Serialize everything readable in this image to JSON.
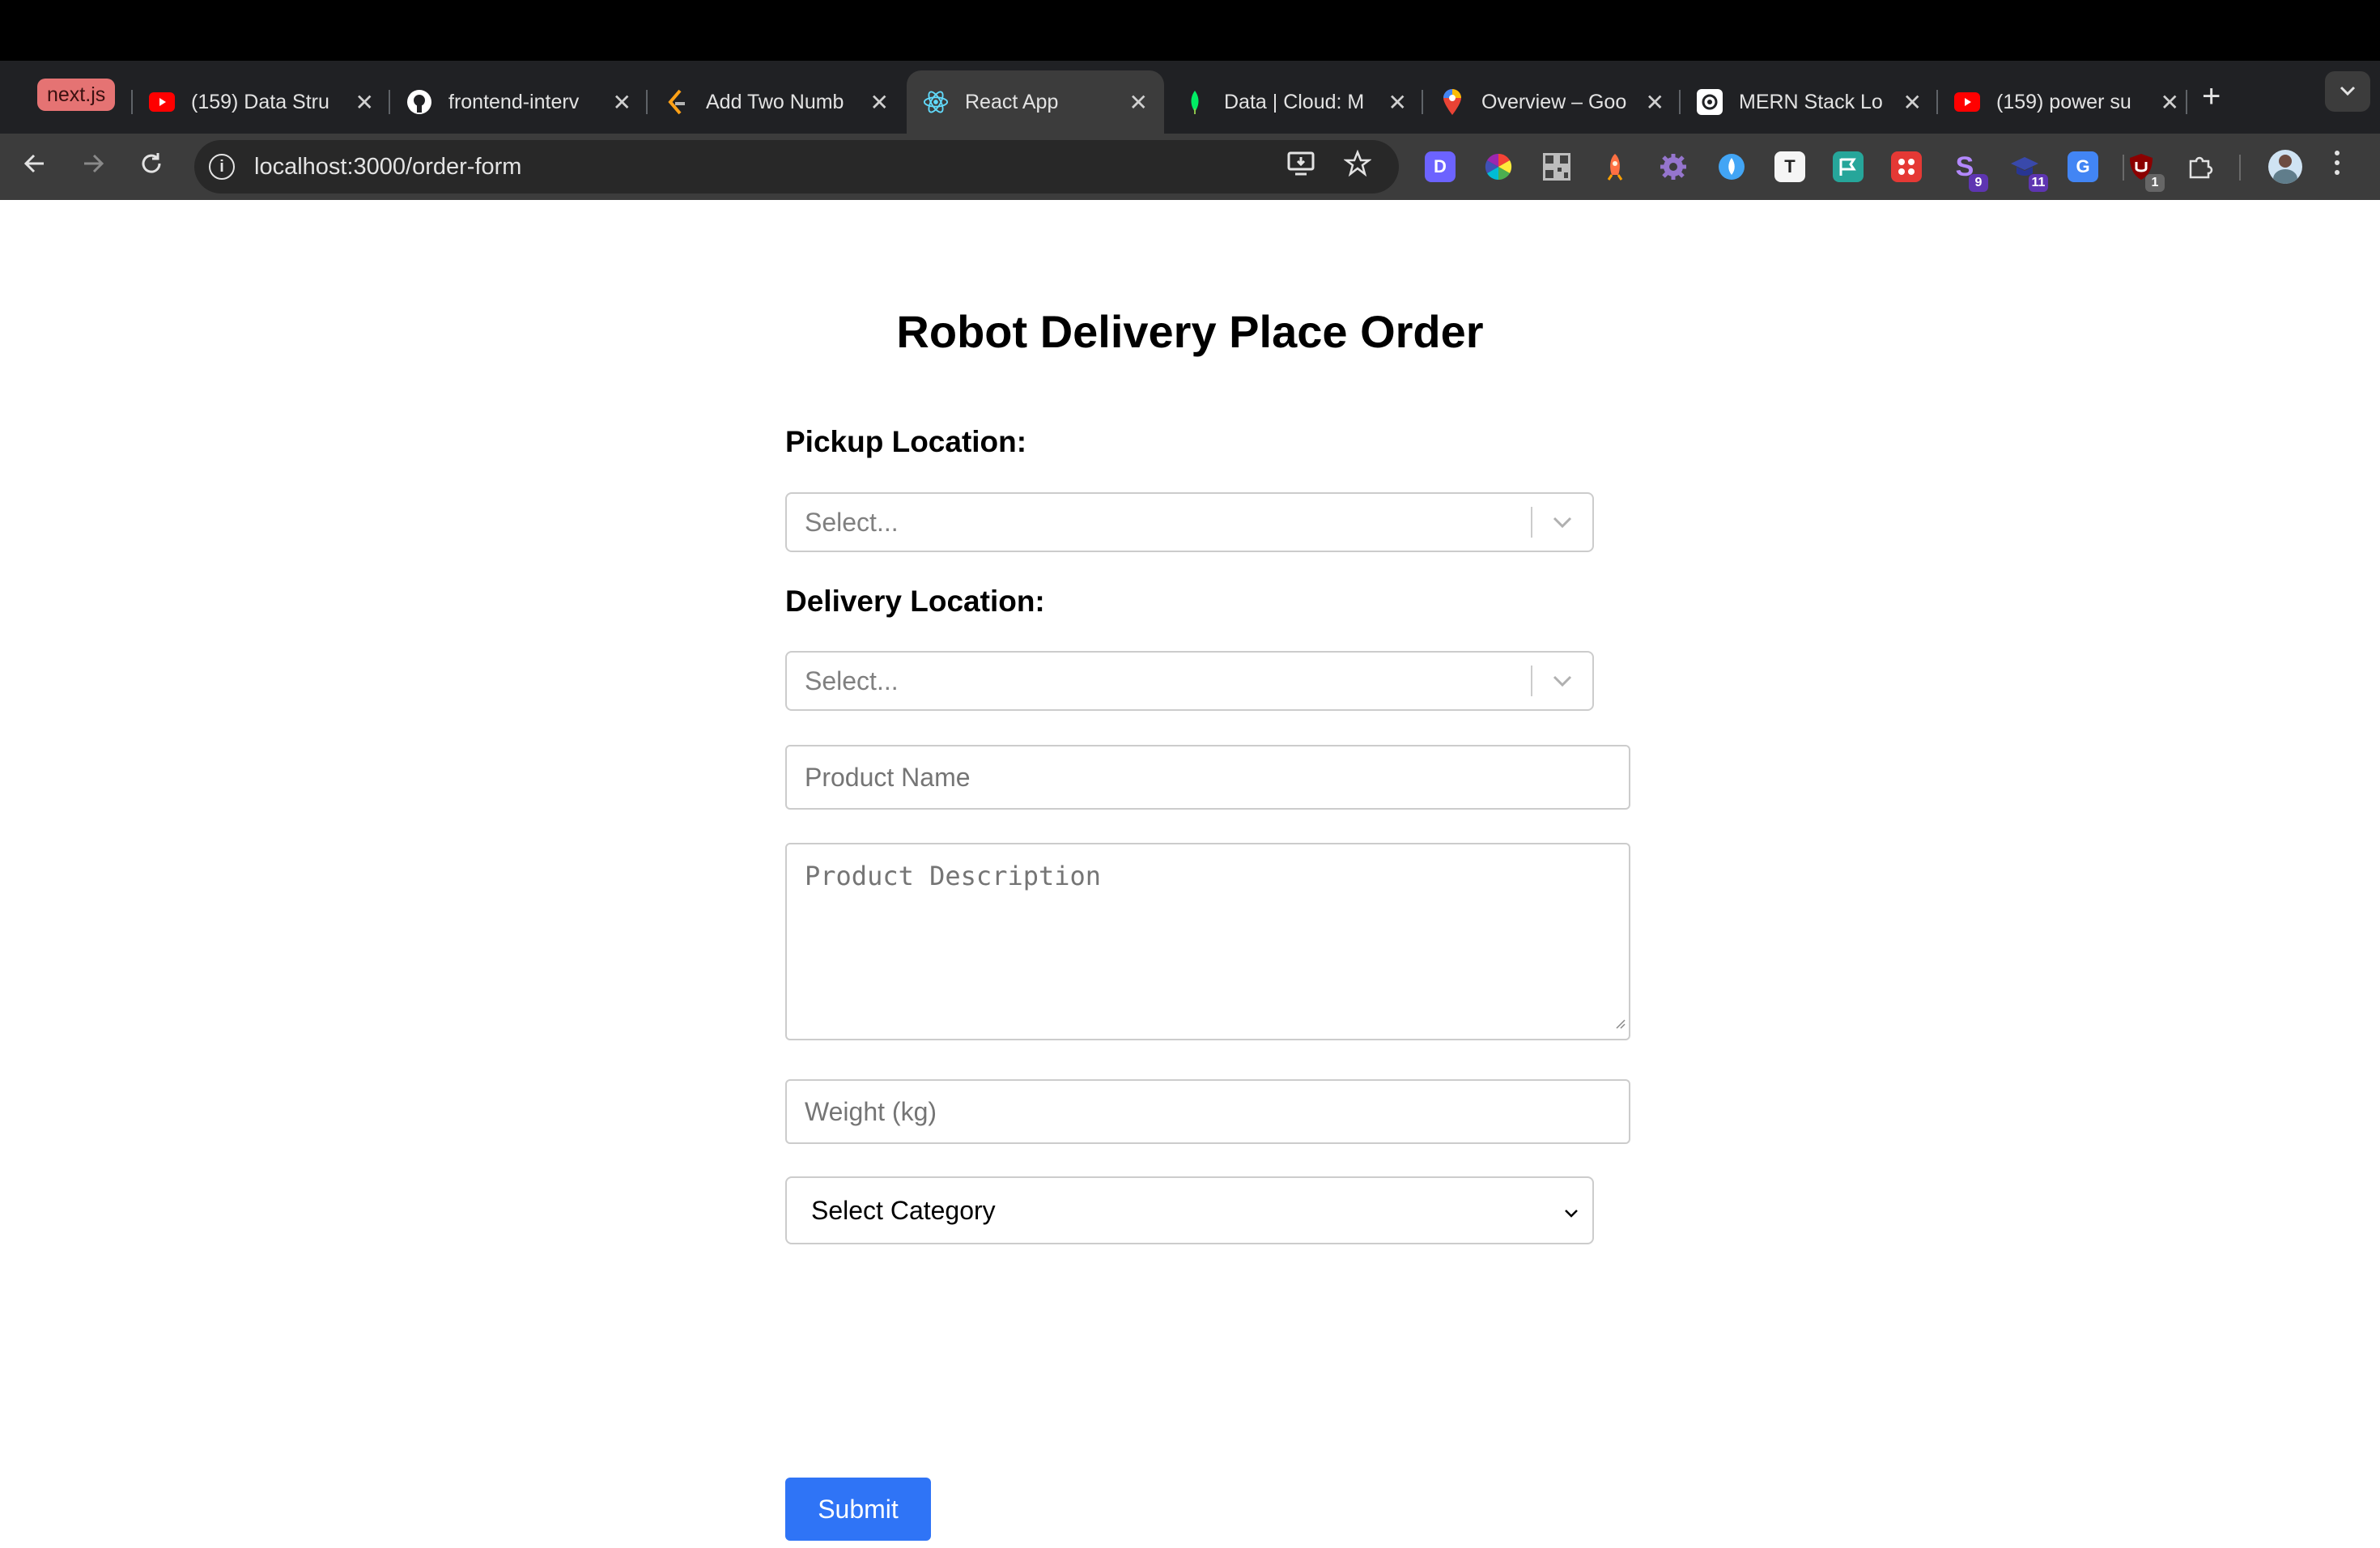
{
  "browser": {
    "tab_group_label": "next.js",
    "tabs": [
      {
        "title": "(159) Data Stru",
        "icon": "youtube-icon"
      },
      {
        "title": "frontend-interv",
        "icon": "github-icon"
      },
      {
        "title": "Add Two Numb",
        "icon": "leetcode-icon"
      },
      {
        "title": "React App",
        "icon": "react-icon",
        "active": true
      },
      {
        "title": "Data | Cloud: M",
        "icon": "mongodb-icon"
      },
      {
        "title": "Overview – Goo",
        "icon": "google-maps-icon"
      },
      {
        "title": "MERN Stack Lo",
        "icon": "openai-icon"
      },
      {
        "title": "(159) power su",
        "icon": "youtube-icon"
      }
    ],
    "new_tab_symbol": "+",
    "url": "localhost:3000/order-form",
    "extensions": [
      {
        "icon": "d-extension-icon",
        "letter": "D",
        "color": "#6c63ff"
      },
      {
        "icon": "color-wheel-icon",
        "color": "#ff9800"
      },
      {
        "icon": "qr-code-icon",
        "color": "#9e9e9e"
      },
      {
        "icon": "rocket-icon",
        "color": "#ff7043"
      },
      {
        "icon": "gear-extension-icon",
        "color": "#7e57c2"
      },
      {
        "icon": "droplet-extension-icon",
        "color": "#42a5f5"
      },
      {
        "icon": "t-extension-icon",
        "letter": "T",
        "color": "#e0e0e0"
      },
      {
        "icon": "flag-extension-icon",
        "color": "#26a69a"
      },
      {
        "icon": "grid-extension-icon",
        "color": "#e53935"
      },
      {
        "icon": "s-extension-icon",
        "letter": "S",
        "color": "#7e57c2",
        "badge": "9"
      },
      {
        "icon": "graduation-cap-icon",
        "color": "#5e35b1",
        "badge": "11"
      },
      {
        "icon": "google-translate-icon",
        "letter": "G",
        "color": "#4285f4"
      },
      {
        "icon": "ublock-icon",
        "color": "#8b0000",
        "badge": "1"
      }
    ]
  },
  "page": {
    "title": "Robot Delivery Place Order",
    "pickup_label": "Pickup Location:",
    "pickup_placeholder": "Select...",
    "delivery_label": "Delivery Location:",
    "delivery_placeholder": "Select...",
    "product_name_placeholder": "Product Name",
    "product_description_placeholder": "Product Description",
    "weight_placeholder": "Weight (kg)",
    "category_selected": "Select Category",
    "submit_label": "Submit"
  },
  "colors": {
    "accent": "#2f74f6",
    "border": "#cccccc",
    "placeholder": "#808080"
  }
}
